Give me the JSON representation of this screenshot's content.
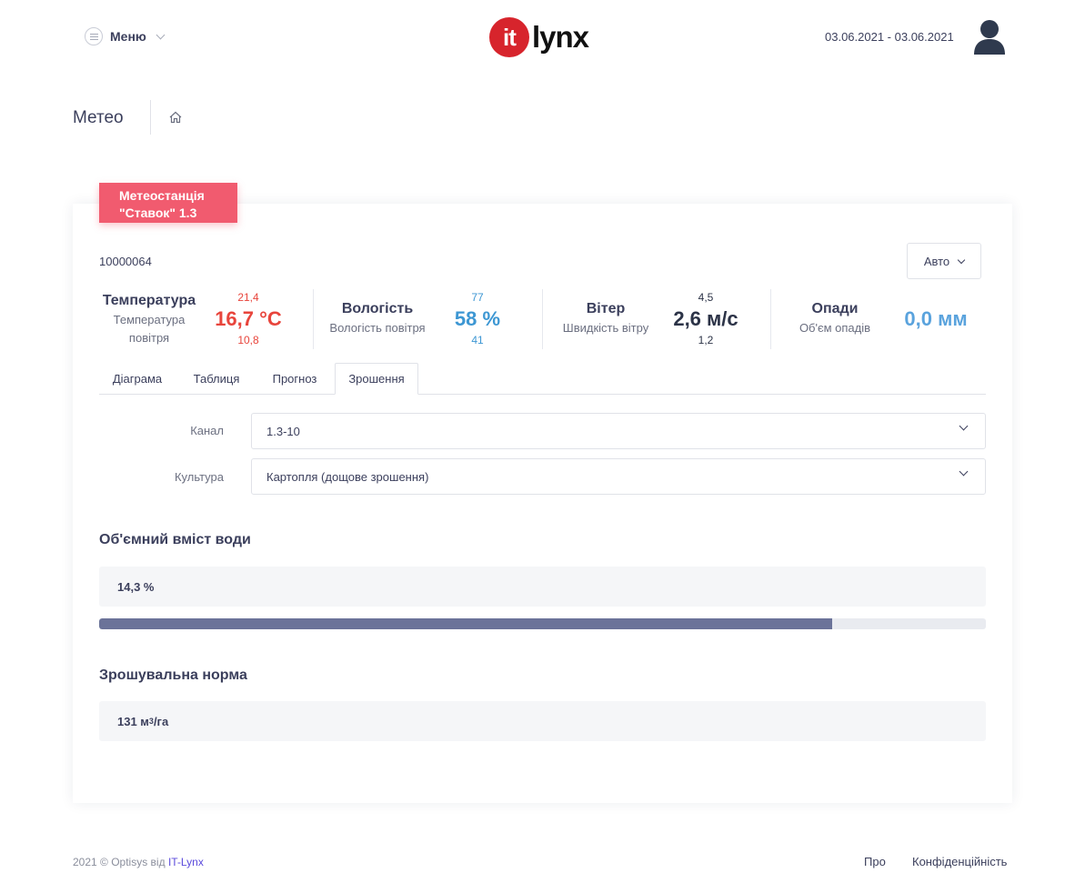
{
  "header": {
    "menu_label": "Меню",
    "logo_it": "it",
    "logo_text": "lynx",
    "date_range": "03.06.2021 - 03.06.2021"
  },
  "page": {
    "title": "Метео"
  },
  "station": {
    "badge_line1": "Метеостанція",
    "badge_line2": "\"Ставок\" 1.3",
    "id": "10000064",
    "mode_button": "Авто"
  },
  "metrics": {
    "temperature": {
      "title": "Температура",
      "subtitle_line1": "Температура",
      "subtitle_line2": "повітря",
      "value": "16,7 °C",
      "max": "21,4",
      "min": "10,8",
      "color": "#e8453c"
    },
    "humidity": {
      "title": "Вологість",
      "subtitle": "Вологість повітря",
      "value": "58 %",
      "max": "77",
      "min": "41",
      "color": "#3d97d3"
    },
    "wind": {
      "title": "Вітер",
      "subtitle": "Швидкість вітру",
      "value": "2,6 м/с",
      "max": "4,5",
      "min": "1,2",
      "color": "#2c3347"
    },
    "precipitation": {
      "title": "Опади",
      "subtitle": "Об'єм опадів",
      "value": "0,0 мм",
      "color": "#5aa3dd"
    }
  },
  "tabs": [
    {
      "label": "Діаграма",
      "active": false
    },
    {
      "label": "Таблиця",
      "active": false
    },
    {
      "label": "Прогноз",
      "active": false
    },
    {
      "label": "Зрошення",
      "active": true
    }
  ],
  "form": {
    "channel_label": "Канал",
    "channel_value": "1.3-10",
    "crop_label": "Культура",
    "crop_value": "Картопля (дощове зрошення)"
  },
  "water_content": {
    "title": "Об'ємний вміст води",
    "value": "14,3 %",
    "progress_percent": 82.7,
    "progress_color": "#6b7399"
  },
  "irrigation": {
    "title": "Зрошувальна норма",
    "value_number": "131 м",
    "value_sup": "3",
    "value_unit": "/га"
  },
  "footer": {
    "copyright": "2021 © Optisys від ",
    "company_link": "IT-Lynx",
    "about": "Про",
    "privacy": "Конфіденційність"
  }
}
